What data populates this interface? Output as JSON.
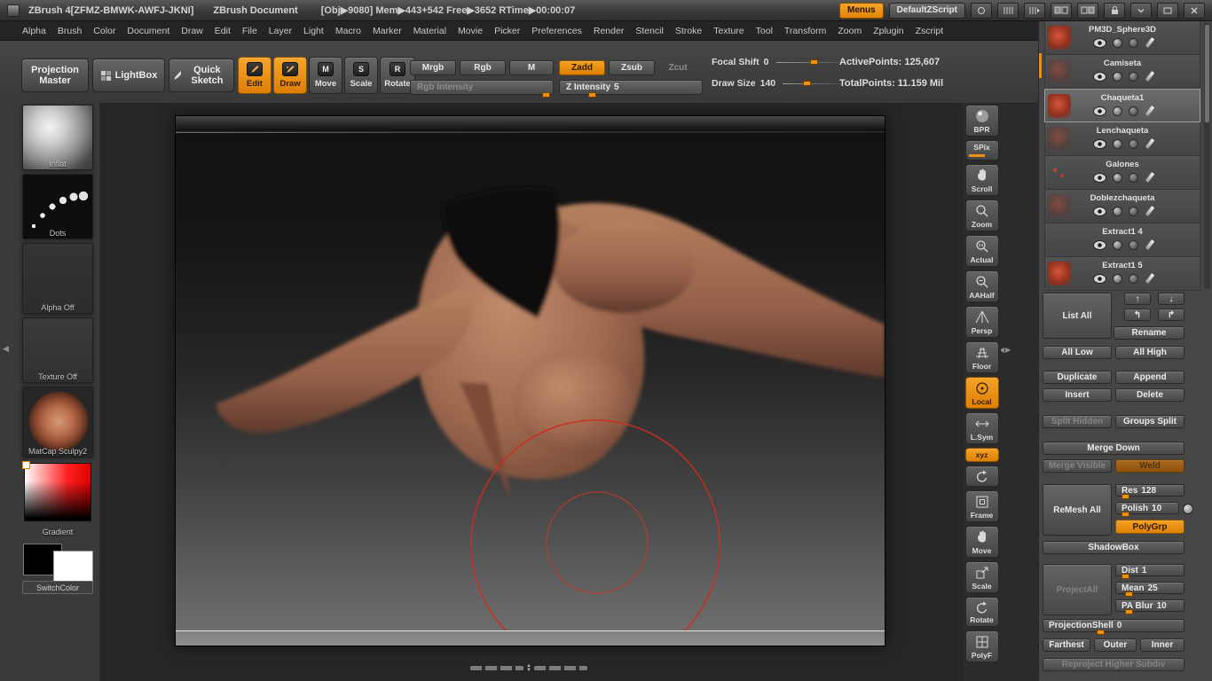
{
  "colors": {
    "accent": "#ED8C0C",
    "skin": "#A06A50",
    "cursor_red": "#CF2B1E"
  },
  "title_bar": {
    "app_title": "ZBrush 4[ZFMZ-BMWK-AWFJ-JKNI]",
    "doc_title": "ZBrush Document",
    "stats": "[Obj▶9080] Mem▶443+542 Free▶3652 RTime▶00:00:07",
    "menus_button": "Menus",
    "zscript_button": "DefaultZScript"
  },
  "menu_bar": [
    "Alpha",
    "Brush",
    "Color",
    "Document",
    "Draw",
    "Edit",
    "File",
    "Layer",
    "Light",
    "Macro",
    "Marker",
    "Material",
    "Movie",
    "Picker",
    "Preferences",
    "Render",
    "Stencil",
    "Stroke",
    "Texture",
    "Tool",
    "Transform",
    "Zoom",
    "Zplugin",
    "Zscript"
  ],
  "top_shelf": {
    "projection_master": "Projection Master",
    "lightbox": "LightBox",
    "quick_sketch": "Quick Sketch",
    "edit": "Edit",
    "draw": "Draw",
    "move": "Move",
    "scale": "Scale",
    "rotate": "Rotate",
    "move_badge": "M",
    "scale_badge": "S",
    "rotate_badge": "R",
    "mrgb": "Mrgb",
    "rgb": "Rgb",
    "m": "M",
    "rgb_intensity": "Rgb Intensity",
    "zadd": "Zadd",
    "zsub": "Zsub",
    "zcut": "Zcut",
    "z_intensity": {
      "label": "Z Intensity",
      "value": "5"
    },
    "focal_shift": {
      "label": "Focal Shift",
      "value": "0"
    },
    "draw_size": {
      "label": "Draw Size",
      "value": "140"
    },
    "active_points": "ActivePoints: 125,607",
    "total_points": "TotalPoints: 11.159 Mil"
  },
  "left_shelf": {
    "brush": "Inflat",
    "stroke": "Dots",
    "alpha": "Alpha Off",
    "texture": "Texture Off",
    "material": "MatCap Sculpy2",
    "gradient": "Gradient",
    "switch_color": "SwitchColor"
  },
  "right_strip": {
    "items": [
      "BPR",
      "SPix",
      "Scroll",
      "Zoom",
      "Actual",
      "AAHalf",
      "Persp",
      "Floor",
      "Local",
      "L.Sym",
      "xyz",
      "Frame",
      "Move",
      "Scale",
      "Rotate",
      "PolyF"
    ]
  },
  "subtools": {
    "items": [
      {
        "name": "PM3D_Sphere3D"
      },
      {
        "name": "Camiseta"
      },
      {
        "name": "Chaqueta1"
      },
      {
        "name": "Lenchaqueta"
      },
      {
        "name": "Galones"
      },
      {
        "name": "Doblezchaqueta"
      },
      {
        "name": "Extract1 4"
      },
      {
        "name": "Extract1 5"
      }
    ]
  },
  "tool_panel": {
    "list_all": "List All",
    "rename": "Rename",
    "all_low": "All Low",
    "all_high": "All High",
    "duplicate": "Duplicate",
    "append": "Append",
    "insert": "Insert",
    "delete": "Delete",
    "split_hidden": "Split Hidden",
    "groups_split": "Groups Split",
    "merge_down": "Merge Down",
    "merge_visible": "Merge Visible",
    "weld": "Weld",
    "remesh_all": "ReMesh All",
    "res": {
      "label": "Res",
      "value": "128"
    },
    "polish": {
      "label": "Polish",
      "value": "10"
    },
    "polygrp": "PolyGrp",
    "shadowbox": "ShadowBox",
    "project_all": "ProjectAll",
    "dist": {
      "label": "Dist",
      "value": "1"
    },
    "mean": {
      "label": "Mean",
      "value": "25"
    },
    "pa_blur": {
      "label": "PA Blur",
      "value": "10"
    },
    "projection_shell": {
      "label": "ProjectionShell",
      "value": "0"
    },
    "farthest": "Farthest",
    "outer": "Outer",
    "inner": "Inner",
    "reproject": "Reproject Higher Subdiv"
  },
  "misc": {
    "arrow_up": "↑",
    "arrow_down": "↓",
    "arrow_move_up": "↰",
    "arrow_move_down": "↱",
    "scroll_up": "▲",
    "scroll_down": "▼",
    "left_edge_arrow": "◀",
    "divider_arrows": "◀▶"
  }
}
